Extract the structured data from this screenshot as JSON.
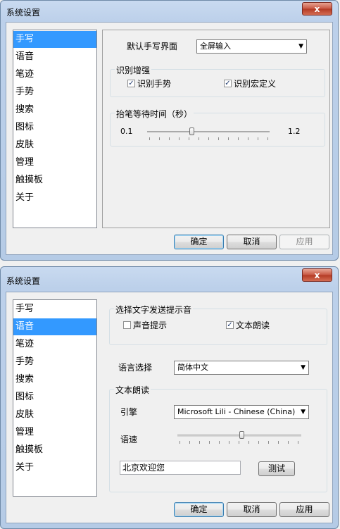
{
  "window1": {
    "title": "系统设置",
    "close_label": "x",
    "sidebar": [
      "手写",
      "语音",
      "笔迹",
      "手势",
      "搜索",
      "图标",
      "皮肤",
      "管理",
      "触摸板",
      "关于"
    ],
    "selected_index": 0,
    "default_ui_label": "默认手写界面",
    "default_ui_value": "全屏输入",
    "recog_group": "识别增强",
    "chk_gesture": "识别手势",
    "chk_gesture_checked": true,
    "chk_macro": "识别宏定义",
    "chk_macro_checked": true,
    "wait_group": "抬笔等待时间（秒）",
    "wait_min": "0.1",
    "wait_max": "1.2",
    "buttons": {
      "ok": "确定",
      "cancel": "取消",
      "apply": "应用"
    }
  },
  "window2": {
    "title": "系统设置",
    "close_label": "x",
    "sidebar": [
      "手写",
      "语音",
      "笔迹",
      "手势",
      "搜索",
      "图标",
      "皮肤",
      "管理",
      "触摸板",
      "关于"
    ],
    "selected_index": 1,
    "sound_group": "选择文字发送提示音",
    "chk_sound": "声音提示",
    "chk_sound_checked": false,
    "chk_tts": "文本朗读",
    "chk_tts_checked": true,
    "lang_label": "语言选择",
    "lang_value": "简体中文",
    "tts_group": "文本朗读",
    "engine_label": "引擎",
    "engine_value": "Microsoft Lili - Chinese (China)",
    "speed_label": "语速",
    "test_text": "北京欢迎您",
    "test_button": "测试",
    "buttons": {
      "ok": "确定",
      "cancel": "取消",
      "apply": "应用"
    }
  }
}
